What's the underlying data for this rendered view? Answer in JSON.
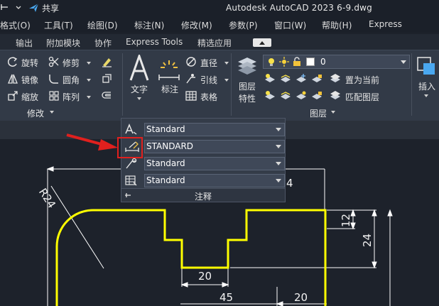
{
  "titlebar": {
    "share_label": "共享",
    "title": "Autodesk AutoCAD 2023    6-9.dwg"
  },
  "menubar": {
    "items": [
      "格式(O)",
      "工具(T)",
      "绘图(D)",
      "标注(N)",
      "修改(M)",
      "参数(P)",
      "窗口(W)",
      "帮助(H)",
      "Express"
    ]
  },
  "tabs": {
    "items": [
      "输出",
      "附加模块",
      "协作",
      "Express Tools",
      "精选应用"
    ]
  },
  "modify_panel": {
    "rotate": "旋转",
    "trim": "修剪",
    "mirror": "镜像",
    "fillet": "圆角",
    "scale": "缩放",
    "array": "阵列",
    "footer": "修改"
  },
  "annotation_panel": {
    "text": "文字",
    "dimension": "标注",
    "linear": "直径",
    "leader": "引线",
    "table": "表格"
  },
  "layer_panel": {
    "layer_props_line1": "图层",
    "layer_props_line2": "特性",
    "current_layer": "0",
    "set_current": "置为当前",
    "match_layer": "匹配图层",
    "footer": "图层"
  },
  "insert_panel": {
    "insert": "插入"
  },
  "flyout": {
    "text_style": "Standard",
    "dim_style": "STANDARD",
    "leader_style": "Standard",
    "table_style": "Standard",
    "footer": "注释"
  },
  "drawing": {
    "dims": {
      "radius": "R24",
      "top_right": "4",
      "v12": "12",
      "v24": "24",
      "slot_width": "20",
      "bottom_45": "45",
      "bottom_20": "20"
    }
  },
  "colors": {
    "outline": "#ffff00",
    "dim_line": "#ffffff",
    "highlight": "#e0201e",
    "arrow": "#e0201e"
  }
}
